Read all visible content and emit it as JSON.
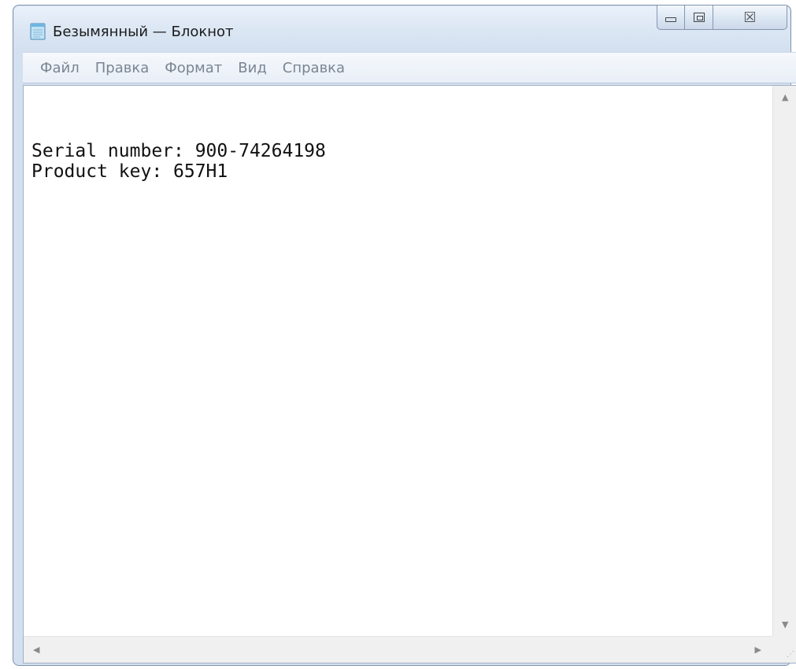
{
  "window": {
    "title": "Безымянный — Блокнот",
    "app_icon": "notepad-icon",
    "controls": {
      "minimize_icon": "minimize-icon",
      "maximize_icon": "maximize-icon",
      "close_icon": "close-icon",
      "close_glyph": "☒"
    }
  },
  "menu": {
    "items": [
      {
        "label": "Файл"
      },
      {
        "label": "Правка"
      },
      {
        "label": "Формат"
      },
      {
        "label": "Вид"
      },
      {
        "label": "Справка"
      }
    ]
  },
  "editor": {
    "lines": [
      "Serial number: 900-74264198",
      "Product key: 657H1"
    ]
  },
  "scrollbars": {
    "up_arrow": "▲",
    "down_arrow": "▼",
    "left_arrow": "◀",
    "right_arrow": "▶",
    "grip": "⋰"
  },
  "colors": {
    "frame": "#7f93ad",
    "menu_text": "#7a8593",
    "text": "#111111"
  }
}
